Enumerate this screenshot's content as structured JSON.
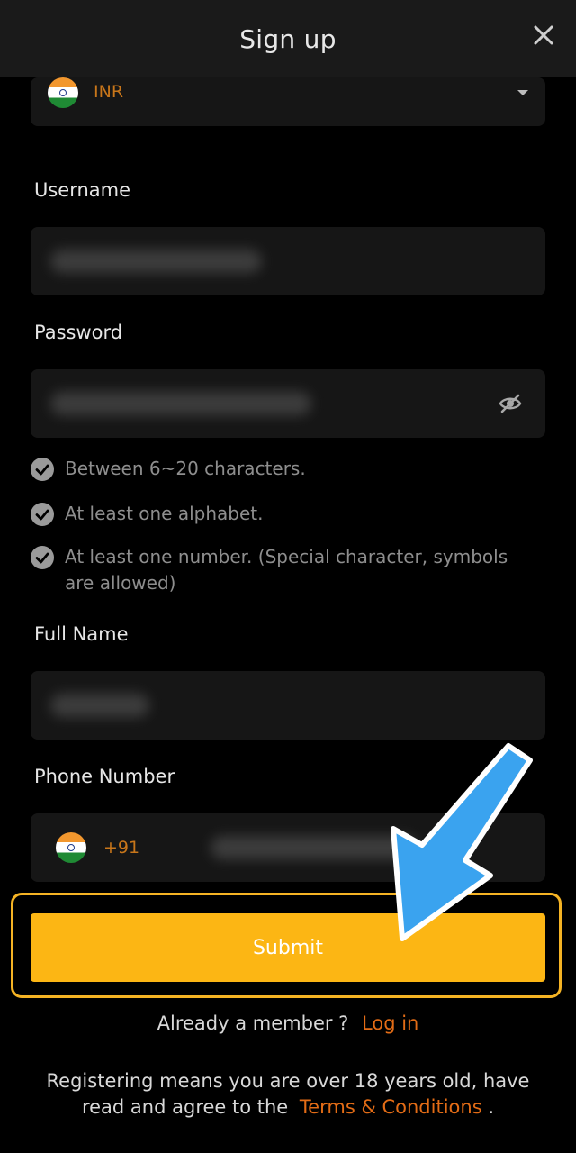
{
  "header": {
    "title": "Sign up"
  },
  "currency": {
    "code": "INR"
  },
  "username": {
    "label": "Username"
  },
  "password": {
    "label": "Password"
  },
  "requirements": [
    "Between 6~20 characters.",
    "At least one alphabet.",
    "At least one number. (Special character, symbols are allowed)"
  ],
  "full_name": {
    "label": "Full Name"
  },
  "phone": {
    "label": "Phone Number",
    "code": "+91"
  },
  "submit": {
    "label": "Submit"
  },
  "login": {
    "prompt": "Already a member ?",
    "link": "Log in"
  },
  "legal": {
    "text_before": "Registering means you are over 18 years old, have read and agree to the",
    "link": "Terms & Conditions",
    "text_after": "."
  },
  "colors": {
    "accent": "#fcb614",
    "link": "#e36c16",
    "arrow": "#3aa3ef"
  },
  "icons": [
    "close-icon",
    "india-flag-icon",
    "dropdown-caret-icon",
    "eye-slash-icon",
    "check-circle-icon",
    "arrow-annotation-icon"
  ]
}
